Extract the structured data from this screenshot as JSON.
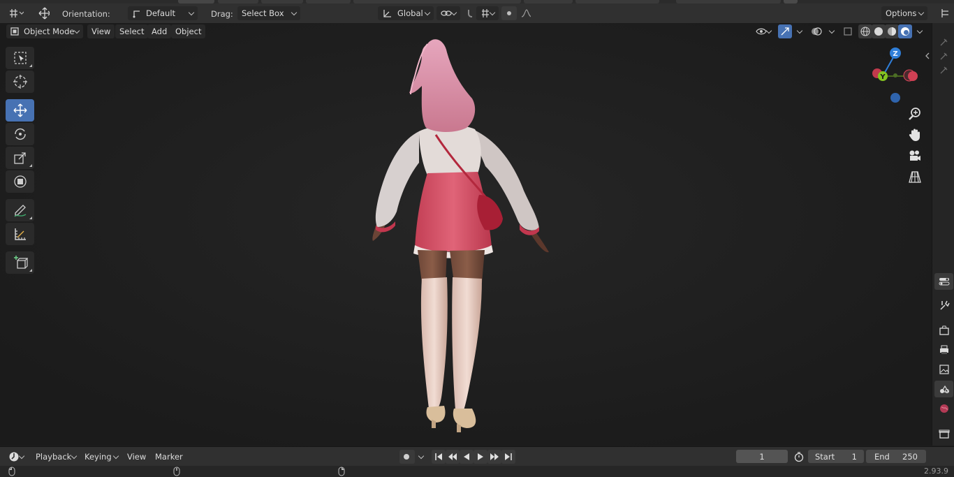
{
  "top_header": {
    "orientation_label": "Orientation:",
    "orientation_value": "Default",
    "drag_label": "Drag:",
    "drag_value": "Select Box",
    "transform_orientation": "Global",
    "options_label": "Options"
  },
  "viewport_header": {
    "mode": "Object Mode",
    "menus": [
      "View",
      "Select",
      "Add",
      "Object"
    ]
  },
  "toolbar": {
    "tools": [
      "select-box-tool",
      "cursor-tool",
      "move-tool",
      "rotate-tool",
      "scale-tool",
      "transform-tool",
      "annotate-tool",
      "measure-tool",
      "add-cube-tool"
    ],
    "active_tool": "move-tool"
  },
  "gizmo": {
    "axes": [
      "Z",
      "Y"
    ]
  },
  "timeline": {
    "menus": [
      "Playback",
      "Keying",
      "View",
      "Marker"
    ],
    "current_frame": "1",
    "start_label": "Start",
    "start_value": "1",
    "end_label": "End",
    "end_value": "250"
  },
  "status": {
    "version": "2.93.9"
  },
  "colors": {
    "accent": "#4772b3",
    "header": "#303030",
    "viewport": "#1e1e1e",
    "axis_x": "#e0475b",
    "axis_y": "#84c321",
    "axis_z": "#2f7ed8"
  }
}
